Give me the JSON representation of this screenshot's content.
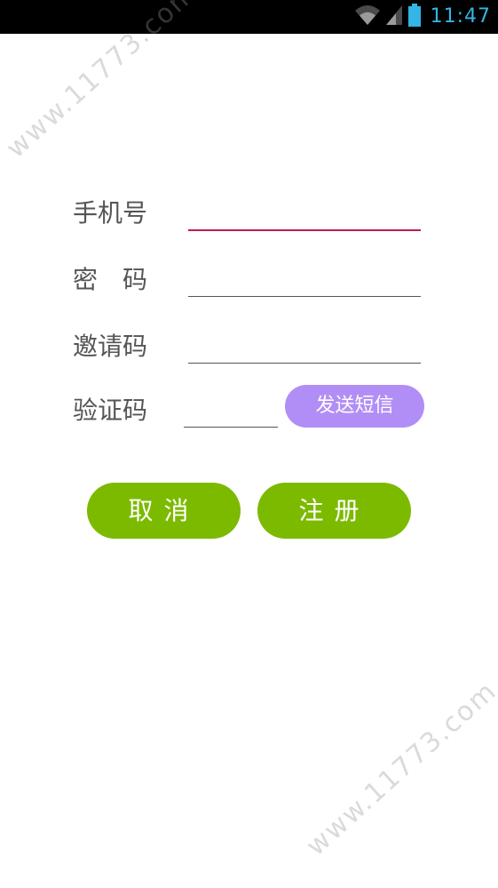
{
  "status_bar": {
    "time": "11:47",
    "icons": [
      "wifi-icon",
      "signal-icon",
      "battery-icon"
    ],
    "time_color": "#33b5e5"
  },
  "form": {
    "phone": {
      "label": "手机号",
      "value": ""
    },
    "password": {
      "label": "密　码",
      "value": ""
    },
    "invite": {
      "label": "邀请码",
      "value": ""
    },
    "code": {
      "label": "验证码",
      "value": ""
    },
    "send_sms_label": "发送短信"
  },
  "actions": {
    "cancel_label": "取消",
    "register_label": "注册"
  },
  "watermark": {
    "text": "www.11773.com"
  },
  "colors": {
    "accent_focus": "#c2185b",
    "sms_button": "#b18ef6",
    "action_button": "#7cba00"
  }
}
